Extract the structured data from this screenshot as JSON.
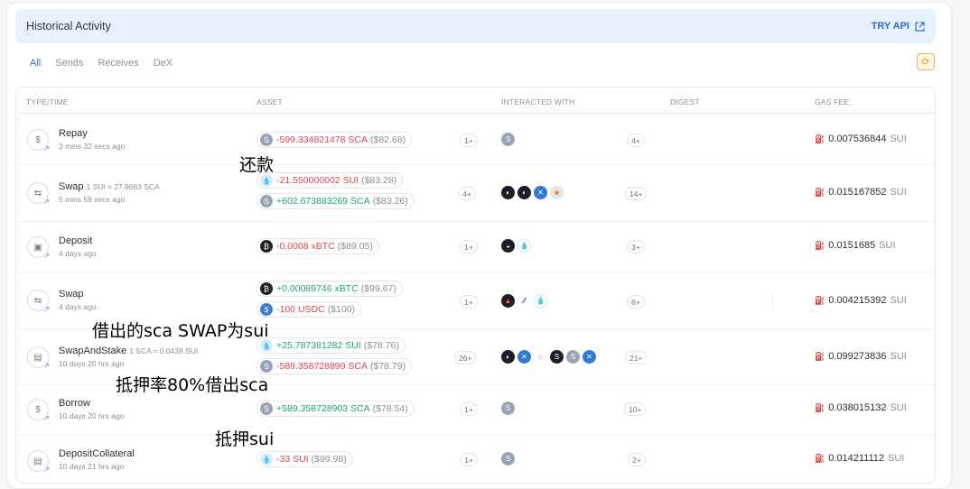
{
  "header": {
    "title": "Historical Activity",
    "api_label": "TRY API"
  },
  "tabs": [
    "All",
    "Sends",
    "Receives",
    "DeX"
  ],
  "columns": {
    "type": "TYPE/TIME",
    "asset": "ASSET",
    "interacted": "INTERACTED WITH",
    "digest": "DIGEST",
    "gas": "GAS FEE"
  },
  "rows": [
    {
      "type": "Repay",
      "sub": "",
      "time": "3 mins 32 secs ago",
      "assets": [
        {
          "amount": "-599.334821478 SCA",
          "usd": "($82.68)",
          "coin": "sca"
        }
      ],
      "asset_count": "1+",
      "interacted_count": "4+",
      "gas": "0.007536844",
      "gas_unit": "SUI"
    },
    {
      "type": "Swap",
      "sub": "1 SUI ≈ 27.9663 SCA",
      "time": "5 mins 59 secs ago",
      "assets": [
        {
          "amount": "-21.550000002 SUI",
          "usd": "($83.28)",
          "coin": "sui"
        },
        {
          "amount": "+602.673883269 SCA",
          "usd": "($83.26)",
          "coin": "sca"
        }
      ],
      "asset_count": "4+",
      "interacted_count": "14+",
      "gas": "0.015167852",
      "gas_unit": "SUI"
    },
    {
      "type": "Deposit",
      "sub": "",
      "time": "4 days ago",
      "assets": [
        {
          "amount": "-0.0008 xBTC",
          "usd": "($89.05)",
          "coin": "btc"
        }
      ],
      "asset_count": "1+",
      "interacted_count": "3+",
      "gas": "0.0151685",
      "gas_unit": "SUI"
    },
    {
      "type": "Swap",
      "sub": "",
      "time": "4 days ago",
      "assets": [
        {
          "amount": "+0.00089746 xBTC",
          "usd": "($99.67)",
          "coin": "btc"
        },
        {
          "amount": "-100 USDC",
          "usd": "($100)",
          "coin": "usdc"
        }
      ],
      "asset_count": "1+",
      "interacted_count": "6+",
      "gas": "0.004215392",
      "gas_unit": "SUI"
    },
    {
      "type": "SwapAndStake",
      "sub": "1 SCA ≈ 0.0438 SUI",
      "time": "10 days 20 hrs ago",
      "assets": [
        {
          "amount": "+25.787381282 SUI",
          "usd": "($78.76)",
          "coin": "sui"
        },
        {
          "amount": "-589.358728899 SCA",
          "usd": "($78.79)",
          "coin": "sca"
        }
      ],
      "asset_count": "26+",
      "interacted_count": "21+",
      "gas": "0.099273836",
      "gas_unit": "SUI"
    },
    {
      "type": "Borrow",
      "sub": "",
      "time": "10 days 20 hrs ago",
      "assets": [
        {
          "amount": "+589.358728903 SCA",
          "usd": "($78.54)",
          "coin": "sca"
        }
      ],
      "asset_count": "1+",
      "interacted_count": "10+",
      "gas": "0.038015132",
      "gas_unit": "SUI"
    },
    {
      "type": "DepositCollateral",
      "sub": "",
      "time": "10 days 21 hrs ago",
      "assets": [
        {
          "amount": "-33 SUI",
          "usd": "($99.98)",
          "coin": "sui"
        }
      ],
      "asset_count": "1+",
      "interacted_count": "2+",
      "gas": "0.014211112",
      "gas_unit": "SUI"
    }
  ],
  "annotations": [
    "还款",
    "借出的sca SWAP为sui",
    "抵押率80%借出sca",
    "抵押sui"
  ],
  "colors": {
    "negative": "#e5484d",
    "positive": "#1fa66a",
    "accent": "#2e6bd6",
    "header_bg": "#e6f1fd"
  }
}
